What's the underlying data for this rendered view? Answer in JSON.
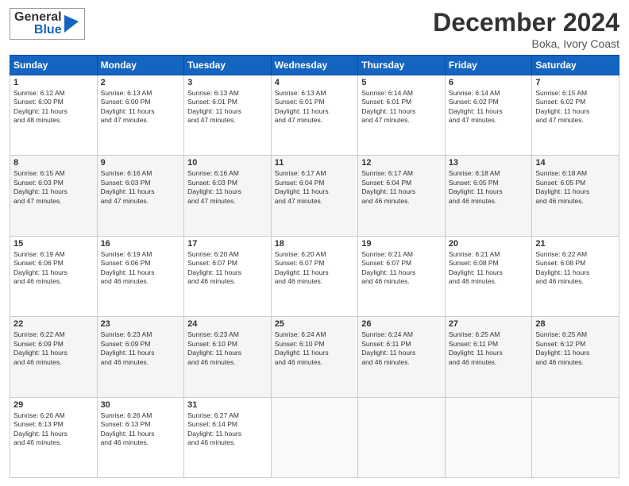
{
  "header": {
    "logo_line1": "General",
    "logo_line2": "Blue",
    "month": "December 2024",
    "location": "Boka, Ivory Coast"
  },
  "weekdays": [
    "Sunday",
    "Monday",
    "Tuesday",
    "Wednesday",
    "Thursday",
    "Friday",
    "Saturday"
  ],
  "weeks": [
    [
      {
        "day": "1",
        "info": "Sunrise: 6:12 AM\nSunset: 6:00 PM\nDaylight: 11 hours\nand 48 minutes."
      },
      {
        "day": "2",
        "info": "Sunrise: 6:13 AM\nSunset: 6:00 PM\nDaylight: 11 hours\nand 47 minutes."
      },
      {
        "day": "3",
        "info": "Sunrise: 6:13 AM\nSunset: 6:01 PM\nDaylight: 11 hours\nand 47 minutes."
      },
      {
        "day": "4",
        "info": "Sunrise: 6:13 AM\nSunset: 6:01 PM\nDaylight: 11 hours\nand 47 minutes."
      },
      {
        "day": "5",
        "info": "Sunrise: 6:14 AM\nSunset: 6:01 PM\nDaylight: 11 hours\nand 47 minutes."
      },
      {
        "day": "6",
        "info": "Sunrise: 6:14 AM\nSunset: 6:02 PM\nDaylight: 11 hours\nand 47 minutes."
      },
      {
        "day": "7",
        "info": "Sunrise: 6:15 AM\nSunset: 6:02 PM\nDaylight: 11 hours\nand 47 minutes."
      }
    ],
    [
      {
        "day": "8",
        "info": "Sunrise: 6:15 AM\nSunset: 6:03 PM\nDaylight: 11 hours\nand 47 minutes."
      },
      {
        "day": "9",
        "info": "Sunrise: 6:16 AM\nSunset: 6:03 PM\nDaylight: 11 hours\nand 47 minutes."
      },
      {
        "day": "10",
        "info": "Sunrise: 6:16 AM\nSunset: 6:03 PM\nDaylight: 11 hours\nand 47 minutes."
      },
      {
        "day": "11",
        "info": "Sunrise: 6:17 AM\nSunset: 6:04 PM\nDaylight: 11 hours\nand 47 minutes."
      },
      {
        "day": "12",
        "info": "Sunrise: 6:17 AM\nSunset: 6:04 PM\nDaylight: 11 hours\nand 46 minutes."
      },
      {
        "day": "13",
        "info": "Sunrise: 6:18 AM\nSunset: 6:05 PM\nDaylight: 11 hours\nand 46 minutes."
      },
      {
        "day": "14",
        "info": "Sunrise: 6:18 AM\nSunset: 6:05 PM\nDaylight: 11 hours\nand 46 minutes."
      }
    ],
    [
      {
        "day": "15",
        "info": "Sunrise: 6:19 AM\nSunset: 6:06 PM\nDaylight: 11 hours\nand 46 minutes."
      },
      {
        "day": "16",
        "info": "Sunrise: 6:19 AM\nSunset: 6:06 PM\nDaylight: 11 hours\nand 46 minutes."
      },
      {
        "day": "17",
        "info": "Sunrise: 6:20 AM\nSunset: 6:07 PM\nDaylight: 11 hours\nand 46 minutes."
      },
      {
        "day": "18",
        "info": "Sunrise: 6:20 AM\nSunset: 6:07 PM\nDaylight: 11 hours\nand 46 minutes."
      },
      {
        "day": "19",
        "info": "Sunrise: 6:21 AM\nSunset: 6:07 PM\nDaylight: 11 hours\nand 46 minutes."
      },
      {
        "day": "20",
        "info": "Sunrise: 6:21 AM\nSunset: 6:08 PM\nDaylight: 11 hours\nand 46 minutes."
      },
      {
        "day": "21",
        "info": "Sunrise: 6:22 AM\nSunset: 6:08 PM\nDaylight: 11 hours\nand 46 minutes."
      }
    ],
    [
      {
        "day": "22",
        "info": "Sunrise: 6:22 AM\nSunset: 6:09 PM\nDaylight: 11 hours\nand 46 minutes."
      },
      {
        "day": "23",
        "info": "Sunrise: 6:23 AM\nSunset: 6:09 PM\nDaylight: 11 hours\nand 46 minutes."
      },
      {
        "day": "24",
        "info": "Sunrise: 6:23 AM\nSunset: 6:10 PM\nDaylight: 11 hours\nand 46 minutes."
      },
      {
        "day": "25",
        "info": "Sunrise: 6:24 AM\nSunset: 6:10 PM\nDaylight: 11 hours\nand 46 minutes."
      },
      {
        "day": "26",
        "info": "Sunrise: 6:24 AM\nSunset: 6:11 PM\nDaylight: 11 hours\nand 46 minutes."
      },
      {
        "day": "27",
        "info": "Sunrise: 6:25 AM\nSunset: 6:11 PM\nDaylight: 11 hours\nand 46 minutes."
      },
      {
        "day": "28",
        "info": "Sunrise: 6:25 AM\nSunset: 6:12 PM\nDaylight: 11 hours\nand 46 minutes."
      }
    ],
    [
      {
        "day": "29",
        "info": "Sunrise: 6:26 AM\nSunset: 6:13 PM\nDaylight: 11 hours\nand 46 minutes."
      },
      {
        "day": "30",
        "info": "Sunrise: 6:26 AM\nSunset: 6:13 PM\nDaylight: 11 hours\nand 46 minutes."
      },
      {
        "day": "31",
        "info": "Sunrise: 6:27 AM\nSunset: 6:14 PM\nDaylight: 11 hours\nand 46 minutes."
      },
      null,
      null,
      null,
      null
    ]
  ]
}
